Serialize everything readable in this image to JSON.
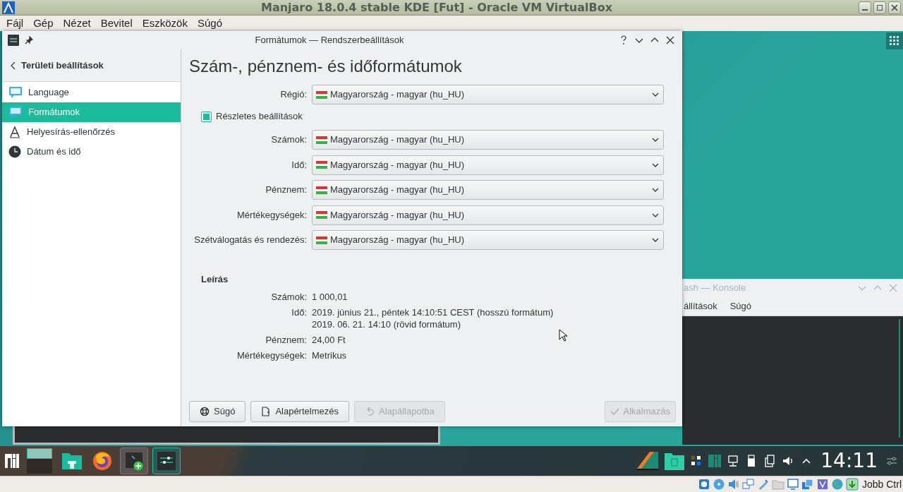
{
  "vm_window": {
    "title": "Manjaro 18.0.4 stable KDE [Fut] - Oracle VM VirtualBox",
    "menu": [
      "Fájl",
      "Gép",
      "Nézet",
      "Bevitel",
      "Eszközök",
      "Súgó"
    ]
  },
  "settings_window": {
    "title": "Formátumok — Rendszerbeállítások",
    "back_label": "Területi beállítások",
    "sidebar": [
      {
        "label": "Language",
        "kind": "bubble",
        "selected": false
      },
      {
        "label": "Formátumok",
        "kind": "bubble",
        "selected": true
      },
      {
        "label": "Helyesírás-ellenőrzés",
        "kind": "letter",
        "selected": false
      },
      {
        "label": "Dátum és idő",
        "kind": "clock",
        "selected": false
      }
    ],
    "heading": "Szám-, pénznem- és időformátumok",
    "region": {
      "label": "Régió:",
      "value": "Magyarország - magyar (hu_HU)"
    },
    "detailed": {
      "label": "Részletes beállítások",
      "checked": true
    },
    "format_rows": [
      {
        "label": "Számok:",
        "value": "Magyarország - magyar (hu_HU)"
      },
      {
        "label": "Idő:",
        "value": "Magyarország - magyar (hu_HU)"
      },
      {
        "label": "Pénznem:",
        "value": "Magyarország - magyar (hu_HU)"
      },
      {
        "label": "Mértékegységek:",
        "value": "Magyarország - magyar (hu_HU)"
      },
      {
        "label": "Szétválogatás és rendezés:",
        "value": "Magyarország - magyar (hu_HU)"
      }
    ],
    "description": {
      "title": "Leírás",
      "rows": [
        {
          "label": "Számok:",
          "lines": [
            "1 000,01"
          ]
        },
        {
          "label": "Idő:",
          "lines": [
            "2019. június 21., péntek 14:10:51 CEST (hosszú formátum)",
            "2019. 06. 21. 14:10 (rövid formátum)"
          ]
        },
        {
          "label": "Pénznem:",
          "lines": [
            "24,00 Ft"
          ]
        },
        {
          "label": "Mértékegységek:",
          "lines": [
            "Metrikus"
          ]
        }
      ]
    },
    "buttons_left": [
      {
        "label": "Súgó",
        "kind": "help",
        "disabled": false
      },
      {
        "label": "Alapértelmezés",
        "kind": "defaults",
        "disabled": false
      },
      {
        "label": "Alapállapotba",
        "kind": "undo",
        "disabled": true
      }
    ],
    "apply_button": {
      "label": "Alkalmazás",
      "disabled": true
    }
  },
  "konsole": {
    "title": "ash — Konsole",
    "menu": [
      "állítások",
      "Súgó"
    ]
  },
  "taskbar": {
    "clock": "14:11"
  },
  "status_bar": {
    "host_key": "Jobb Ctrl"
  }
}
